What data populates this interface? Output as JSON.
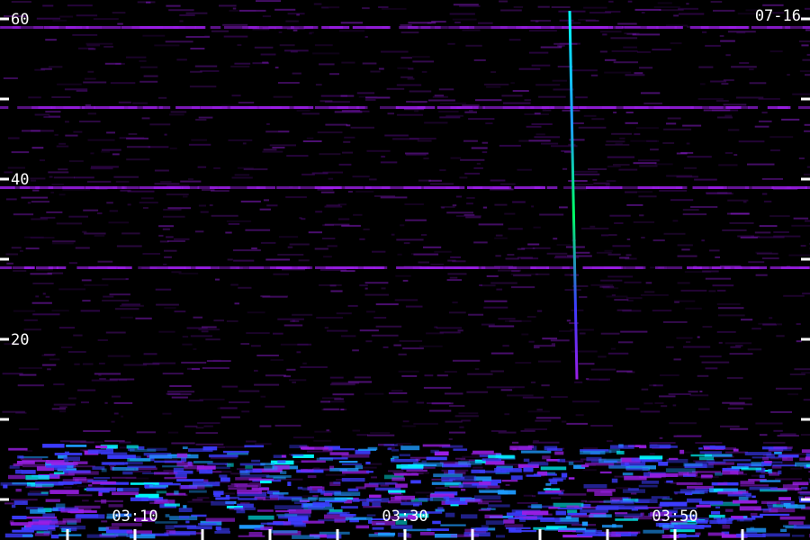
{
  "chart_data": {
    "type": "heatmap",
    "title": "",
    "corner_label": "07-16",
    "xlabel": "",
    "ylabel": "",
    "y_ticks": [
      {
        "value": 60,
        "label": "60"
      },
      {
        "value": 50,
        "label": ""
      },
      {
        "value": 40,
        "label": "40"
      },
      {
        "value": 30,
        "label": ""
      },
      {
        "value": 20,
        "label": ""
      },
      {
        "value": 10,
        "label": ""
      },
      {
        "value": 20,
        "label": "20"
      }
    ],
    "y_tick_values": [
      60,
      50,
      40,
      30,
      20,
      10,
      0
    ],
    "y_tick_labels": [
      "60",
      "",
      "40",
      "",
      "20",
      "",
      ""
    ],
    "ylim": [
      0,
      62
    ],
    "x_tick_labels": [
      {
        "minute": 10,
        "label": "03:10"
      },
      {
        "minute": 30,
        "label": "03:30"
      },
      {
        "minute": 50,
        "label": "03:50"
      }
    ],
    "x_minor_ticks_minutes": [
      5,
      10,
      15,
      20,
      25,
      30,
      35,
      40,
      45,
      50,
      55
    ],
    "xlim_minutes": [
      0,
      60
    ],
    "x_time_prefix": "03:",
    "grid": false,
    "colormap": [
      "#000000",
      "#5a0a8c",
      "#9b1ee6",
      "#3c3cff",
      "#1e9bff",
      "#00ffff",
      "#00ff64",
      "#ffff00",
      "#ffffff"
    ],
    "features": {
      "bright_spike": {
        "minute": 42.2,
        "y_top": 61,
        "y_bottom": 15
      },
      "horizontal_lines_y": [
        60,
        50,
        40,
        30
      ],
      "low_band_y": [
        0,
        7
      ]
    }
  }
}
